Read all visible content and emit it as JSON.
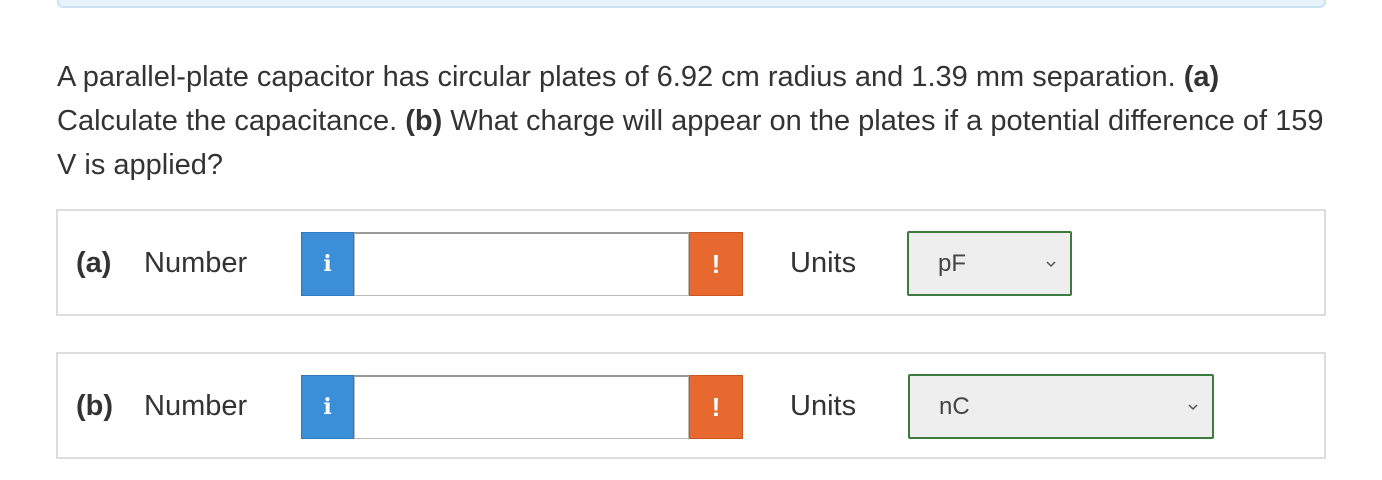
{
  "question": {
    "text1": "A parallel-plate capacitor has circular plates of 6.92 cm radius and 1.39 mm separation. ",
    "part_a_marker": "(a)",
    "text2": " Calculate the capacitance. ",
    "part_b_marker": "(b)",
    "text3": " What charge will appear on the plates if a potential difference of 159 V is applied?"
  },
  "parts": [
    {
      "label": "(a)",
      "number_label": "Number",
      "info_icon": "i",
      "number_value": "",
      "warning_icon": "!",
      "units_label": "Units",
      "units_selected": "pF"
    },
    {
      "label": "(b)",
      "number_label": "Number",
      "info_icon": "i",
      "number_value": "",
      "warning_icon": "!",
      "units_label": "Units",
      "units_selected": "nC"
    }
  ],
  "colors": {
    "info_button": "#3b8fd9",
    "warning_button": "#e8692f",
    "select_border": "#3d7a3d"
  }
}
